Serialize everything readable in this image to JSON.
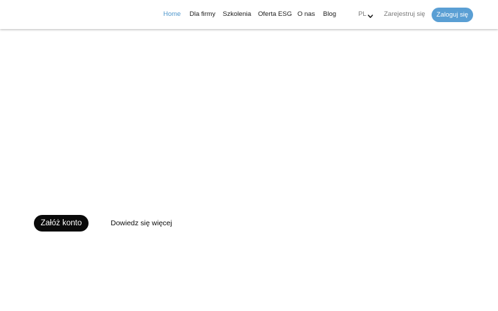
{
  "header": {
    "nav": {
      "home": "Home",
      "companies": "Dla firmy",
      "trainings": "Szkolenia",
      "esg_offer": "Oferta ESG",
      "about": "O nas",
      "blog": "Blog"
    },
    "active_item": "Home",
    "language": {
      "selected": "PL",
      "icon": "chevron-down-icon"
    },
    "register_label": "Zarejestruj się",
    "login_label": "Zaloguj się"
  },
  "hero": {
    "primary_cta": "Załóż konto",
    "secondary_cta": "Dowiedz się więcej"
  },
  "colors": {
    "accent": "#5a9fd4",
    "active_link": "#4f97cc",
    "primary_button": "#0a0a0a",
    "muted_text": "#7a7a7a"
  }
}
